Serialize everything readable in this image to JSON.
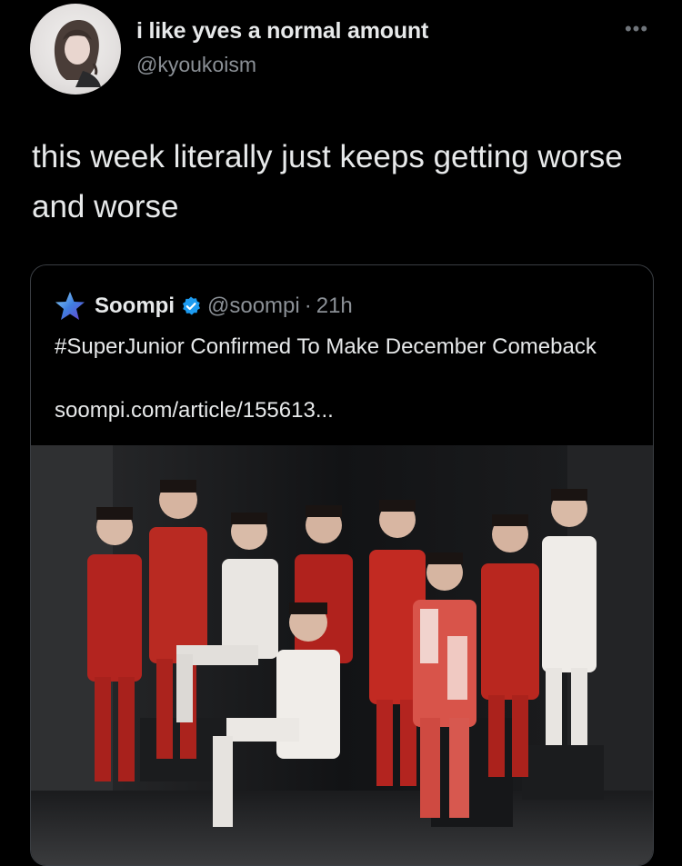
{
  "tweet": {
    "display_name": "i like yves a normal amount",
    "handle": "@kyoukoism",
    "more_icon": "more-horizontal-icon",
    "text": "this week literally just keeps getting worse and worse"
  },
  "quoted_tweet": {
    "name": "Soompi",
    "verified_icon": "verified-badge-icon",
    "handle": "@soompi",
    "separator": "·",
    "time": "21h",
    "text": "#SuperJunior Confirmed To Make December Comeback",
    "link": "soompi.com/article/155613..."
  },
  "colors": {
    "background": "#000000",
    "text": "#e7e9ea",
    "secondary_text": "#8b9096",
    "verified_blue": "#1d9bf0",
    "card_border": "#3a3e43"
  }
}
